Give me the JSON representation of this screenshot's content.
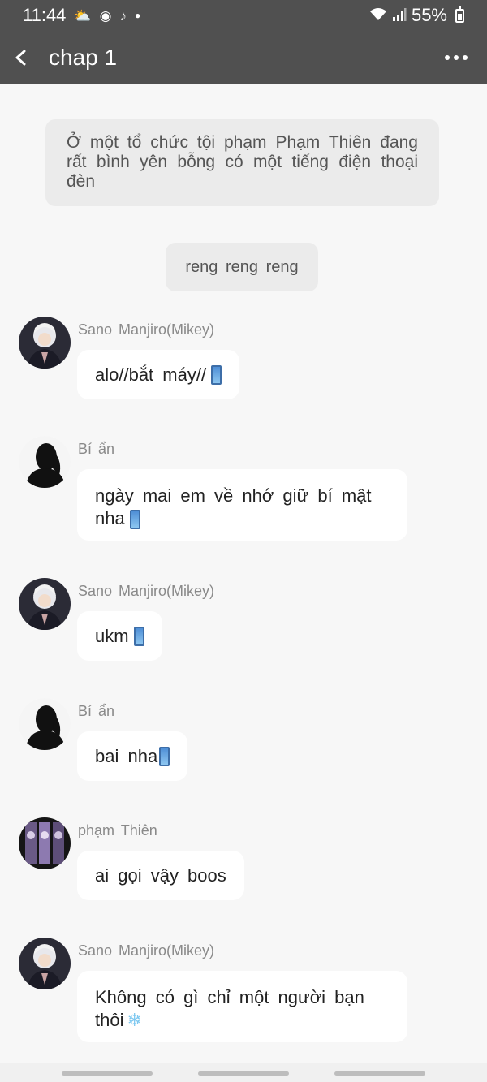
{
  "status_bar": {
    "time": "11:44",
    "left_icons": [
      "weather-icon",
      "chrome-icon",
      "tiktok-icon",
      "dot-icon"
    ],
    "battery": "55%",
    "right_icons": [
      "wifi-icon",
      "signal-icon",
      "battery-icon"
    ]
  },
  "header": {
    "title": "chap 1",
    "back_icon": "chevron-left-icon",
    "menu_icon": "more-dots-icon"
  },
  "narration": {
    "text": "Ở một tổ chức tội phạm Phạm Thiên đang rất bình yên bỗng có một tiếng điện thoại đèn"
  },
  "sound_effect": {
    "text": "reng reng reng"
  },
  "messages": [
    {
      "sender": "Sano Manjiro(Mikey)",
      "text": "alo//bắt máy//",
      "emoji": "phone-emoji",
      "avatar": "mikey-avatar"
    },
    {
      "sender": "Bí ẩn",
      "text": "ngày mai em về nhớ giữ bí mật nha",
      "emoji": "phone-emoji",
      "avatar": "silhouette-avatar"
    },
    {
      "sender": "Sano Manjiro(Mikey)",
      "text": "ukm",
      "emoji": "phone-emoji",
      "avatar": "mikey-avatar"
    },
    {
      "sender": "Bí ẩn",
      "text": "bai nha",
      "emoji": "phone-emoji",
      "avatar": "silhouette-avatar"
    },
    {
      "sender": "phạm Thiên",
      "text": "ai gọi vậy boos",
      "emoji": "",
      "avatar": "sanzu-avatar"
    },
    {
      "sender": "Sano Manjiro(Mikey)",
      "text": "Không có gì chỉ một người bạn thôi",
      "emoji": "snowflake-emoji",
      "avatar": "mikey-avatar"
    }
  ],
  "colors": {
    "header_bg": "#505050",
    "page_bg": "#f7f7f7",
    "narration_bg": "#ebebeb",
    "bubble_bg": "#ffffff",
    "sender_text": "#8a8a8a"
  }
}
